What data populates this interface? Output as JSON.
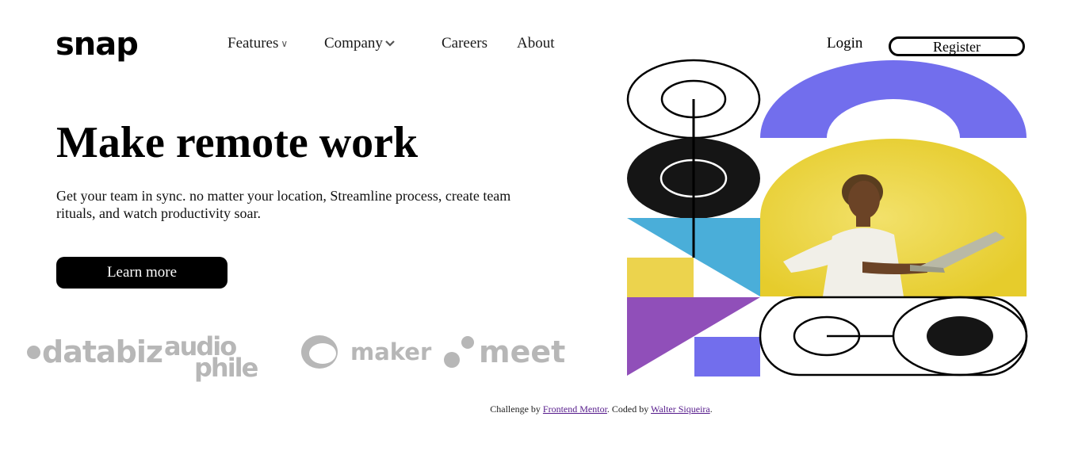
{
  "brand": {
    "logo": "snap"
  },
  "nav": {
    "features": "Features",
    "company": "Company",
    "careers": "Careers",
    "about": "About",
    "chevron": "∨"
  },
  "auth": {
    "login": "Login",
    "register": "Register"
  },
  "hero": {
    "title": "Make remote work",
    "description": "Get your team in sync. no matter your location, Streamline process, create team rituals, and watch productivity soar.",
    "cta": "Learn more"
  },
  "clients": {
    "databiz": "databiz",
    "audiophile_top": "audio",
    "audiophile_bottom": "phile",
    "maker": "maker",
    "meet": "meet"
  },
  "footer": {
    "prefix": "Challenge by ",
    "link1": "Frontend Mentor",
    "middle": ". Coded by ",
    "link2": "Walter Siqueira",
    "suffix": "."
  },
  "colors": {
    "purple": "#726eed",
    "yellow": "#ecd34d",
    "blue": "#4aaed9",
    "violet": "#904fb9",
    "black": "#151515",
    "client_gray": "#b7b7b7"
  },
  "icons": {
    "chevron": "chevron-down-icon"
  }
}
